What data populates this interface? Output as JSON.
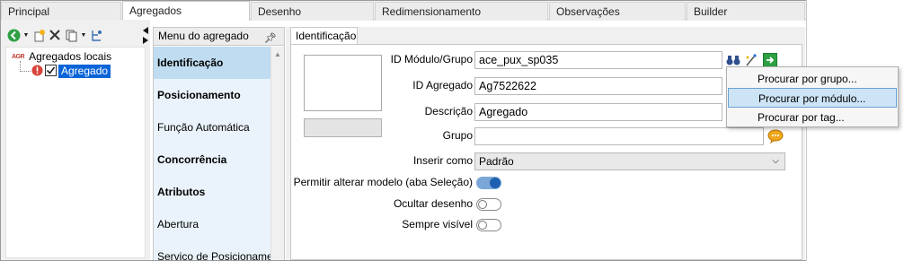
{
  "top_tabs": [
    "Principal",
    "Agregados",
    "Desenho",
    "Redimensionamento",
    "Observações",
    "Builder"
  ],
  "active_tab": "Agregados",
  "tree": {
    "root_tag": "AGR",
    "root_label": "Agregados locais",
    "child_label": "Agregado"
  },
  "menu": {
    "header": "Menu do agregado",
    "items": [
      "Identificação",
      "Posicionamento",
      "Função Automática",
      "Concorrência",
      "Atributos",
      "Abertura",
      "Servico de Posicionamen"
    ]
  },
  "content": {
    "tab": "Identificação",
    "fields": {
      "modulo_label": "ID Módulo/Grupo",
      "modulo_value": "ace_pux_sp035",
      "agregado_label": "ID Agregado",
      "agregado_value": "Ag7522622",
      "descricao_label": "Descrição",
      "descricao_value": "Agregado",
      "grupo_label": "Grupo",
      "grupo_value": "",
      "inserir_label": "Inserir como",
      "inserir_value": "Padrão",
      "permitir_label": "Permitir alterar modelo (aba Seleção)",
      "ocultar_label": "Ocultar desenho",
      "visivel_label": "Sempre visível"
    }
  },
  "popup": [
    "Procurar por grupo...",
    "Procurar por módulo...",
    "Procurar por tag..."
  ],
  "colors": {
    "selection": "#0a64d8",
    "menu_bg": "#eaf3fb",
    "menu_selected": "#bfdcf1",
    "toggle_on": "#1f5fb0"
  },
  "icons": [
    "green-back-icon",
    "new-item-icon",
    "delete-icon",
    "copy-icon",
    "tree-icon",
    "warning-icon",
    "checkbox-icon",
    "pin-icon",
    "binoculars-icon",
    "edit-wand-icon",
    "green-arrow-icon",
    "chat-bubble-icon"
  ]
}
